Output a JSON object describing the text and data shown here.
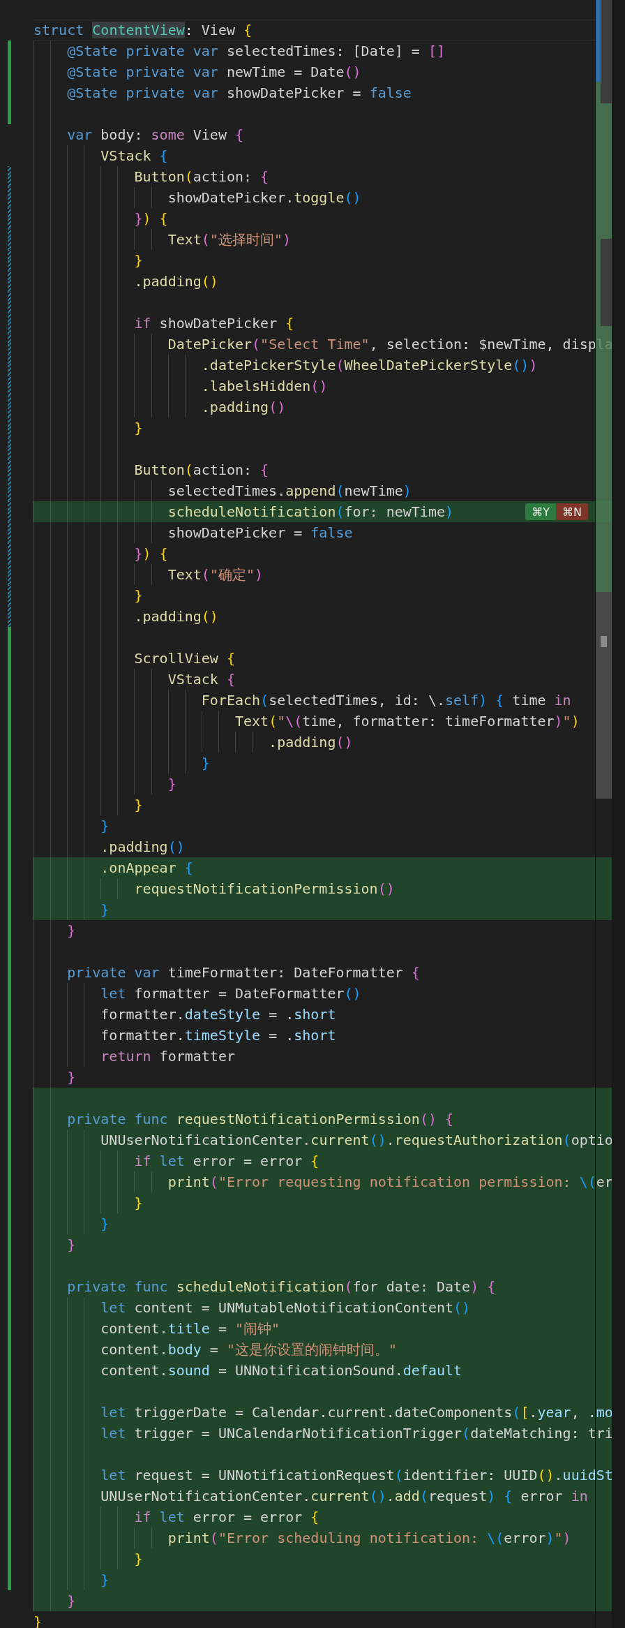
{
  "editor": {
    "lines": [
      {
        "kind": "code",
        "current": true,
        "highlight": false,
        "added": false,
        "modified": false,
        "tokens": [
          {
            "text": "struct ",
            "kind": "kw"
          },
          {
            "text": "ContentView",
            "kind": "match"
          },
          {
            "text": ": View ",
            "kind": "txt"
          },
          {
            "text": "{",
            "kind": "by"
          }
        ]
      },
      {
        "kind": "code",
        "current": false,
        "highlight": false,
        "added": true,
        "modified": false,
        "tokens": [
          {
            "text": "    @State private var",
            "kind": "kw"
          },
          {
            "text": " selectedTimes: [Date] = ",
            "kind": "txt"
          },
          {
            "text": "[]",
            "kind": "bm"
          }
        ]
      },
      {
        "kind": "code",
        "current": false,
        "highlight": false,
        "added": true,
        "modified": false,
        "tokens": [
          {
            "text": "    @State private var",
            "kind": "kw"
          },
          {
            "text": " newTime = Date",
            "kind": "txt"
          },
          {
            "text": "()",
            "kind": "bm"
          }
        ]
      },
      {
        "kind": "code",
        "current": false,
        "highlight": false,
        "added": true,
        "modified": false,
        "tokens": [
          {
            "text": "    @State private var",
            "kind": "kw"
          },
          {
            "text": " showDatePicker = ",
            "kind": "txt"
          },
          {
            "text": "false",
            "kind": "kw"
          }
        ]
      },
      {
        "kind": "blank",
        "current": false,
        "highlight": false,
        "added": true,
        "modified": false
      },
      {
        "kind": "code",
        "current": false,
        "highlight": false,
        "added": false,
        "modified": false,
        "tokens": [
          {
            "text": "    var",
            "kind": "kw"
          },
          {
            "text": " body: ",
            "kind": "txt"
          },
          {
            "text": "some",
            "kind": "ctl"
          },
          {
            "text": " View ",
            "kind": "txt"
          },
          {
            "text": "{",
            "kind": "bm"
          }
        ]
      },
      {
        "kind": "code",
        "current": false,
        "highlight": false,
        "added": false,
        "modified": false,
        "tokens": [
          {
            "text": "        VStack",
            "kind": "fn"
          },
          {
            "text": " {",
            "kind": "bb"
          }
        ]
      },
      {
        "kind": "code",
        "current": false,
        "highlight": false,
        "added": false,
        "modified": true,
        "tokens": [
          {
            "text": "            Button",
            "kind": "fn"
          },
          {
            "text": "(",
            "kind": "by"
          },
          {
            "text": "action: ",
            "kind": "txt"
          },
          {
            "text": "{",
            "kind": "bm"
          }
        ]
      },
      {
        "kind": "code",
        "current": false,
        "highlight": false,
        "added": false,
        "modified": true,
        "tokens": [
          {
            "text": "                showDatePicker.",
            "kind": "txt"
          },
          {
            "text": "toggle",
            "kind": "fn"
          },
          {
            "text": "()",
            "kind": "bb"
          }
        ]
      },
      {
        "kind": "code",
        "current": false,
        "highlight": false,
        "added": false,
        "modified": true,
        "tokens": [
          {
            "text": "            }",
            "kind": "bm"
          },
          {
            "text": ") {",
            "kind": "by"
          }
        ]
      },
      {
        "kind": "code",
        "current": false,
        "highlight": false,
        "added": false,
        "modified": true,
        "tokens": [
          {
            "text": "                Text",
            "kind": "fn"
          },
          {
            "text": "(",
            "kind": "bm"
          },
          {
            "text": "\"选择时间\"",
            "kind": "str"
          },
          {
            "text": ")",
            "kind": "bm"
          }
        ]
      },
      {
        "kind": "code",
        "current": false,
        "highlight": false,
        "added": false,
        "modified": true,
        "tokens": [
          {
            "text": "            }",
            "kind": "by"
          }
        ]
      },
      {
        "kind": "code",
        "current": false,
        "highlight": false,
        "added": false,
        "modified": true,
        "tokens": [
          {
            "text": "            .padding",
            "kind": "fn"
          },
          {
            "text": "()",
            "kind": "by"
          }
        ]
      },
      {
        "kind": "blank",
        "current": false,
        "highlight": false,
        "added": false,
        "modified": true
      },
      {
        "kind": "code",
        "current": false,
        "highlight": false,
        "added": false,
        "modified": true,
        "tokens": [
          {
            "text": "            if",
            "kind": "ctl"
          },
          {
            "text": " showDatePicker ",
            "kind": "txt"
          },
          {
            "text": "{",
            "kind": "by"
          }
        ]
      },
      {
        "kind": "code",
        "current": false,
        "highlight": false,
        "added": false,
        "modified": true,
        "tokens": [
          {
            "text": "                DatePicker",
            "kind": "fn"
          },
          {
            "text": "(",
            "kind": "bm"
          },
          {
            "text": "\"Select Time\"",
            "kind": "str"
          },
          {
            "text": ", selection: $newTime, displa",
            "kind": "txt"
          }
        ]
      },
      {
        "kind": "code",
        "current": false,
        "highlight": false,
        "added": false,
        "modified": true,
        "tokens": [
          {
            "text": "                    .datePickerStyle",
            "kind": "fn"
          },
          {
            "text": "(",
            "kind": "bm"
          },
          {
            "text": "WheelDatePickerStyle",
            "kind": "fn"
          },
          {
            "text": "()",
            "kind": "bb"
          },
          {
            "text": ")",
            "kind": "bm"
          }
        ]
      },
      {
        "kind": "code",
        "current": false,
        "highlight": false,
        "added": false,
        "modified": true,
        "tokens": [
          {
            "text": "                    .labelsHidden",
            "kind": "fn"
          },
          {
            "text": "()",
            "kind": "bm"
          }
        ]
      },
      {
        "kind": "code",
        "current": false,
        "highlight": false,
        "added": false,
        "modified": true,
        "tokens": [
          {
            "text": "                    .padding",
            "kind": "fn"
          },
          {
            "text": "()",
            "kind": "bm"
          }
        ]
      },
      {
        "kind": "code",
        "current": false,
        "highlight": false,
        "added": false,
        "modified": true,
        "tokens": [
          {
            "text": "            }",
            "kind": "by"
          }
        ]
      },
      {
        "kind": "blank",
        "current": false,
        "highlight": false,
        "added": false,
        "modified": true
      },
      {
        "kind": "code",
        "current": false,
        "highlight": false,
        "added": false,
        "modified": true,
        "tokens": [
          {
            "text": "            Button",
            "kind": "fn"
          },
          {
            "text": "(",
            "kind": "by"
          },
          {
            "text": "action: ",
            "kind": "txt"
          },
          {
            "text": "{",
            "kind": "bm"
          }
        ]
      },
      {
        "kind": "code",
        "current": false,
        "highlight": false,
        "added": false,
        "modified": true,
        "tokens": [
          {
            "text": "                selectedTimes.",
            "kind": "txt"
          },
          {
            "text": "append",
            "kind": "fn"
          },
          {
            "text": "(",
            "kind": "bb"
          },
          {
            "text": "newTime",
            "kind": "txt"
          },
          {
            "text": ")",
            "kind": "bb"
          }
        ]
      },
      {
        "kind": "code",
        "current": false,
        "highlight": true,
        "added": false,
        "modified": true,
        "tokens": [
          {
            "text": "                scheduleNotification",
            "kind": "fn"
          },
          {
            "text": "(",
            "kind": "bb"
          },
          {
            "text": "for: newTime",
            "kind": "txt"
          },
          {
            "text": ")",
            "kind": "bb"
          }
        ],
        "actions": [
          {
            "label": "⌘Y",
            "kind": "accept"
          },
          {
            "label": "⌘N",
            "kind": "reject"
          }
        ]
      },
      {
        "kind": "code",
        "current": false,
        "highlight": false,
        "added": false,
        "modified": true,
        "tokens": [
          {
            "text": "                showDatePicker = ",
            "kind": "txt"
          },
          {
            "text": "false",
            "kind": "kw"
          }
        ]
      },
      {
        "kind": "code",
        "current": false,
        "highlight": false,
        "added": false,
        "modified": true,
        "tokens": [
          {
            "text": "            }",
            "kind": "bm"
          },
          {
            "text": ") {",
            "kind": "by"
          }
        ]
      },
      {
        "kind": "code",
        "current": false,
        "highlight": false,
        "added": false,
        "modified": true,
        "tokens": [
          {
            "text": "                Text",
            "kind": "fn"
          },
          {
            "text": "(",
            "kind": "bm"
          },
          {
            "text": "\"确定\"",
            "kind": "str"
          },
          {
            "text": ")",
            "kind": "bm"
          }
        ]
      },
      {
        "kind": "code",
        "current": false,
        "highlight": false,
        "added": false,
        "modified": true,
        "tokens": [
          {
            "text": "            }",
            "kind": "by"
          }
        ]
      },
      {
        "kind": "code",
        "current": false,
        "highlight": false,
        "added": false,
        "modified": true,
        "tokens": [
          {
            "text": "            .padding",
            "kind": "fn"
          },
          {
            "text": "()",
            "kind": "by"
          }
        ]
      },
      {
        "kind": "blank",
        "current": false,
        "highlight": false,
        "added": true,
        "modified": false
      },
      {
        "kind": "code",
        "current": false,
        "highlight": false,
        "added": true,
        "modified": false,
        "tokens": [
          {
            "text": "            ScrollView",
            "kind": "fn"
          },
          {
            "text": " {",
            "kind": "by"
          }
        ]
      },
      {
        "kind": "code",
        "current": false,
        "highlight": false,
        "added": true,
        "modified": false,
        "tokens": [
          {
            "text": "                VStack",
            "kind": "fn"
          },
          {
            "text": " {",
            "kind": "bm"
          }
        ]
      },
      {
        "kind": "code",
        "current": false,
        "highlight": false,
        "added": true,
        "modified": false,
        "tokens": [
          {
            "text": "                    ForEach",
            "kind": "fn"
          },
          {
            "text": "(",
            "kind": "bb"
          },
          {
            "text": "selectedTimes, id: \\.",
            "kind": "txt"
          },
          {
            "text": "self",
            "kind": "kw"
          },
          {
            "text": ") {",
            "kind": "bb"
          },
          {
            "text": " time ",
            "kind": "txt"
          },
          {
            "text": "in",
            "kind": "ctl"
          }
        ]
      },
      {
        "kind": "code",
        "current": false,
        "highlight": false,
        "added": true,
        "modified": false,
        "tokens": [
          {
            "text": "                        Text",
            "kind": "fn"
          },
          {
            "text": "(",
            "kind": "by"
          },
          {
            "text": "\"",
            "kind": "str"
          },
          {
            "text": "\\(",
            "kind": "bm"
          },
          {
            "text": "time, formatter: timeFormatter",
            "kind": "txt"
          },
          {
            "text": ")",
            "kind": "bm"
          },
          {
            "text": "\"",
            "kind": "str"
          },
          {
            "text": ")",
            "kind": "by"
          }
        ]
      },
      {
        "kind": "code",
        "current": false,
        "highlight": false,
        "added": true,
        "modified": false,
        "tokens": [
          {
            "text": "                            .padding",
            "kind": "fn"
          },
          {
            "text": "()",
            "kind": "bm"
          }
        ]
      },
      {
        "kind": "code",
        "current": false,
        "highlight": false,
        "added": true,
        "modified": false,
        "tokens": [
          {
            "text": "                    }",
            "kind": "bb"
          }
        ]
      },
      {
        "kind": "code",
        "current": false,
        "highlight": false,
        "added": true,
        "modified": false,
        "tokens": [
          {
            "text": "                }",
            "kind": "bm"
          }
        ]
      },
      {
        "kind": "code",
        "current": false,
        "highlight": false,
        "added": true,
        "modified": false,
        "tokens": [
          {
            "text": "            }",
            "kind": "by"
          }
        ]
      },
      {
        "kind": "code",
        "current": false,
        "highlight": false,
        "added": true,
        "modified": false,
        "tokens": [
          {
            "text": "        }",
            "kind": "bb"
          }
        ]
      },
      {
        "kind": "code",
        "current": false,
        "highlight": false,
        "added": true,
        "modified": false,
        "tokens": [
          {
            "text": "        .padding",
            "kind": "fn"
          },
          {
            "text": "()",
            "kind": "bb"
          }
        ]
      },
      {
        "kind": "code",
        "current": false,
        "highlight": true,
        "added": true,
        "modified": false,
        "tokens": [
          {
            "text": "        .onAppear",
            "kind": "fn"
          },
          {
            "text": " {",
            "kind": "bb"
          }
        ]
      },
      {
        "kind": "code",
        "current": false,
        "highlight": true,
        "added": true,
        "modified": false,
        "tokens": [
          {
            "text": "            requestNotificationPermission",
            "kind": "fn"
          },
          {
            "text": "()",
            "kind": "bm"
          }
        ]
      },
      {
        "kind": "code",
        "current": false,
        "highlight": true,
        "added": true,
        "modified": false,
        "tokens": [
          {
            "text": "        }",
            "kind": "bb"
          }
        ]
      },
      {
        "kind": "code",
        "current": false,
        "highlight": false,
        "added": true,
        "modified": false,
        "tokens": [
          {
            "text": "    }",
            "kind": "bm"
          }
        ]
      },
      {
        "kind": "blank",
        "current": false,
        "highlight": false,
        "added": true,
        "modified": false
      },
      {
        "kind": "code",
        "current": false,
        "highlight": false,
        "added": true,
        "modified": false,
        "tokens": [
          {
            "text": "    private var",
            "kind": "kw"
          },
          {
            "text": " timeFormatter: DateFormatter ",
            "kind": "txt"
          },
          {
            "text": "{",
            "kind": "bm"
          }
        ]
      },
      {
        "kind": "code",
        "current": false,
        "highlight": false,
        "added": true,
        "modified": false,
        "tokens": [
          {
            "text": "        let",
            "kind": "kw"
          },
          {
            "text": " formatter = DateFormatter",
            "kind": "txt"
          },
          {
            "text": "()",
            "kind": "bb"
          }
        ]
      },
      {
        "kind": "code",
        "current": false,
        "highlight": false,
        "added": true,
        "modified": false,
        "tokens": [
          {
            "text": "        formatter.",
            "kind": "txt"
          },
          {
            "text": "dateStyle",
            "kind": "prop"
          },
          {
            "text": " = .",
            "kind": "txt"
          },
          {
            "text": "short",
            "kind": "prop"
          }
        ]
      },
      {
        "kind": "code",
        "current": false,
        "highlight": false,
        "added": true,
        "modified": false,
        "tokens": [
          {
            "text": "        formatter.",
            "kind": "txt"
          },
          {
            "text": "timeStyle",
            "kind": "prop"
          },
          {
            "text": " = .",
            "kind": "txt"
          },
          {
            "text": "short",
            "kind": "prop"
          }
        ]
      },
      {
        "kind": "code",
        "current": false,
        "highlight": false,
        "added": true,
        "modified": false,
        "tokens": [
          {
            "text": "        return",
            "kind": "ctl"
          },
          {
            "text": " formatter",
            "kind": "txt"
          }
        ]
      },
      {
        "kind": "code",
        "current": false,
        "highlight": false,
        "added": true,
        "modified": false,
        "tokens": [
          {
            "text": "    }",
            "kind": "bm"
          }
        ]
      },
      {
        "kind": "blank",
        "current": false,
        "highlight": true,
        "added": true,
        "modified": false
      },
      {
        "kind": "code",
        "current": false,
        "highlight": true,
        "added": true,
        "modified": false,
        "tokens": [
          {
            "text": "    private func",
            "kind": "kw"
          },
          {
            "text": " requestNotificationPermission",
            "kind": "fn"
          },
          {
            "text": "() {",
            "kind": "bm"
          }
        ]
      },
      {
        "kind": "code",
        "current": false,
        "highlight": true,
        "added": true,
        "modified": false,
        "tokens": [
          {
            "text": "        UNUserNotificationCenter.",
            "kind": "txt"
          },
          {
            "text": "current",
            "kind": "fn"
          },
          {
            "text": "()",
            "kind": "bb"
          },
          {
            "text": ".",
            "kind": "txt"
          },
          {
            "text": "requestAuthorization",
            "kind": "fn"
          },
          {
            "text": "(",
            "kind": "bb"
          },
          {
            "text": "optio",
            "kind": "txt"
          }
        ]
      },
      {
        "kind": "code",
        "current": false,
        "highlight": true,
        "added": true,
        "modified": false,
        "tokens": [
          {
            "text": "            if ",
            "kind": "ctl"
          },
          {
            "text": "let",
            "kind": "kw"
          },
          {
            "text": " error = error ",
            "kind": "txt"
          },
          {
            "text": "{",
            "kind": "by"
          }
        ]
      },
      {
        "kind": "code",
        "current": false,
        "highlight": true,
        "added": true,
        "modified": false,
        "tokens": [
          {
            "text": "                print",
            "kind": "fn"
          },
          {
            "text": "(",
            "kind": "bm"
          },
          {
            "text": "\"Error requesting notification permission: ",
            "kind": "str"
          },
          {
            "text": "\\(",
            "kind": "bb"
          },
          {
            "text": "er",
            "kind": "txt"
          }
        ]
      },
      {
        "kind": "code",
        "current": false,
        "highlight": true,
        "added": true,
        "modified": false,
        "tokens": [
          {
            "text": "            }",
            "kind": "by"
          }
        ]
      },
      {
        "kind": "code",
        "current": false,
        "highlight": true,
        "added": true,
        "modified": false,
        "tokens": [
          {
            "text": "        }",
            "kind": "bb"
          }
        ]
      },
      {
        "kind": "code",
        "current": false,
        "highlight": true,
        "added": true,
        "modified": false,
        "tokens": [
          {
            "text": "    }",
            "kind": "bm"
          }
        ]
      },
      {
        "kind": "blank",
        "current": false,
        "highlight": true,
        "added": true,
        "modified": false
      },
      {
        "kind": "code",
        "current": false,
        "highlight": true,
        "added": true,
        "modified": false,
        "tokens": [
          {
            "text": "    private func",
            "kind": "kw"
          },
          {
            "text": " scheduleNotification",
            "kind": "fn"
          },
          {
            "text": "(",
            "kind": "bm"
          },
          {
            "text": "for date: Date",
            "kind": "txt"
          },
          {
            "text": ") {",
            "kind": "bm"
          }
        ]
      },
      {
        "kind": "code",
        "current": false,
        "highlight": true,
        "added": true,
        "modified": false,
        "tokens": [
          {
            "text": "        let",
            "kind": "kw"
          },
          {
            "text": " content = UNMutableNotificationContent",
            "kind": "txt"
          },
          {
            "text": "()",
            "kind": "bb"
          }
        ]
      },
      {
        "kind": "code",
        "current": false,
        "highlight": true,
        "added": true,
        "modified": false,
        "tokens": [
          {
            "text": "        content.",
            "kind": "txt"
          },
          {
            "text": "title",
            "kind": "prop"
          },
          {
            "text": " = ",
            "kind": "txt"
          },
          {
            "text": "\"闹钟\"",
            "kind": "str"
          }
        ]
      },
      {
        "kind": "code",
        "current": false,
        "highlight": true,
        "added": true,
        "modified": false,
        "tokens": [
          {
            "text": "        content.",
            "kind": "txt"
          },
          {
            "text": "body",
            "kind": "prop"
          },
          {
            "text": " = ",
            "kind": "txt"
          },
          {
            "text": "\"这是你设置的闹钟时间。\"",
            "kind": "str"
          }
        ]
      },
      {
        "kind": "code",
        "current": false,
        "highlight": true,
        "added": true,
        "modified": false,
        "tokens": [
          {
            "text": "        content.",
            "kind": "txt"
          },
          {
            "text": "sound",
            "kind": "prop"
          },
          {
            "text": " = UNNotificationSound.",
            "kind": "txt"
          },
          {
            "text": "default",
            "kind": "prop"
          }
        ]
      },
      {
        "kind": "blank",
        "current": false,
        "highlight": true,
        "added": true,
        "modified": false
      },
      {
        "kind": "code",
        "current": false,
        "highlight": true,
        "added": true,
        "modified": false,
        "tokens": [
          {
            "text": "        let",
            "kind": "kw"
          },
          {
            "text": " triggerDate = Calendar.current.dateComponents",
            "kind": "txt"
          },
          {
            "text": "(",
            "kind": "bb"
          },
          {
            "text": "[",
            "kind": "by"
          },
          {
            "text": ".",
            "kind": "txt"
          },
          {
            "text": "year",
            "kind": "prop"
          },
          {
            "text": ", .",
            "kind": "txt"
          },
          {
            "text": "mo",
            "kind": "prop"
          }
        ]
      },
      {
        "kind": "code",
        "current": false,
        "highlight": true,
        "added": true,
        "modified": false,
        "tokens": [
          {
            "text": "        let",
            "kind": "kw"
          },
          {
            "text": " trigger = UNCalendarNotificationTrigger",
            "kind": "txt"
          },
          {
            "text": "(",
            "kind": "bb"
          },
          {
            "text": "dateMatching: tri",
            "kind": "txt"
          }
        ]
      },
      {
        "kind": "blank",
        "current": false,
        "highlight": true,
        "added": true,
        "modified": false
      },
      {
        "kind": "code",
        "current": false,
        "highlight": true,
        "added": true,
        "modified": false,
        "tokens": [
          {
            "text": "        let",
            "kind": "kw"
          },
          {
            "text": " request = UNNotificationRequest",
            "kind": "txt"
          },
          {
            "text": "(",
            "kind": "bb"
          },
          {
            "text": "identifier: UUID",
            "kind": "txt"
          },
          {
            "text": "()",
            "kind": "by"
          },
          {
            "text": ".",
            "kind": "txt"
          },
          {
            "text": "uuidSt",
            "kind": "prop"
          }
        ]
      },
      {
        "kind": "code",
        "current": false,
        "highlight": true,
        "added": true,
        "modified": false,
        "tokens": [
          {
            "text": "        UNUserNotificationCenter.",
            "kind": "txt"
          },
          {
            "text": "current",
            "kind": "fn"
          },
          {
            "text": "()",
            "kind": "bb"
          },
          {
            "text": ".",
            "kind": "txt"
          },
          {
            "text": "add",
            "kind": "fn"
          },
          {
            "text": "(",
            "kind": "bb"
          },
          {
            "text": "request",
            "kind": "txt"
          },
          {
            "text": ") {",
            "kind": "bb"
          },
          {
            "text": " error ",
            "kind": "txt"
          },
          {
            "text": "in",
            "kind": "ctl"
          }
        ]
      },
      {
        "kind": "code",
        "current": false,
        "highlight": true,
        "added": true,
        "modified": false,
        "tokens": [
          {
            "text": "            if ",
            "kind": "ctl"
          },
          {
            "text": "let",
            "kind": "kw"
          },
          {
            "text": " error = error ",
            "kind": "txt"
          },
          {
            "text": "{",
            "kind": "by"
          }
        ]
      },
      {
        "kind": "code",
        "current": false,
        "highlight": true,
        "added": true,
        "modified": false,
        "tokens": [
          {
            "text": "                print",
            "kind": "fn"
          },
          {
            "text": "(",
            "kind": "bm"
          },
          {
            "text": "\"Error scheduling notification: ",
            "kind": "str"
          },
          {
            "text": "\\(",
            "kind": "bb"
          },
          {
            "text": "error",
            "kind": "txt"
          },
          {
            "text": ")",
            "kind": "bb"
          },
          {
            "text": "\"",
            "kind": "str"
          },
          {
            "text": ")",
            "kind": "bm"
          }
        ]
      },
      {
        "kind": "code",
        "current": false,
        "highlight": true,
        "added": true,
        "modified": false,
        "tokens": [
          {
            "text": "            }",
            "kind": "by"
          }
        ]
      },
      {
        "kind": "code",
        "current": false,
        "highlight": true,
        "added": true,
        "modified": false,
        "tokens": [
          {
            "text": "        }",
            "kind": "bb"
          }
        ]
      },
      {
        "kind": "code",
        "current": false,
        "highlight": true,
        "added": false,
        "modified": false,
        "tokens": [
          {
            "text": "    }",
            "kind": "bm"
          }
        ]
      },
      {
        "kind": "code",
        "current": false,
        "highlight": false,
        "added": false,
        "modified": false,
        "tokens": [
          {
            "text": "}",
            "kind": "by"
          }
        ]
      }
    ]
  }
}
